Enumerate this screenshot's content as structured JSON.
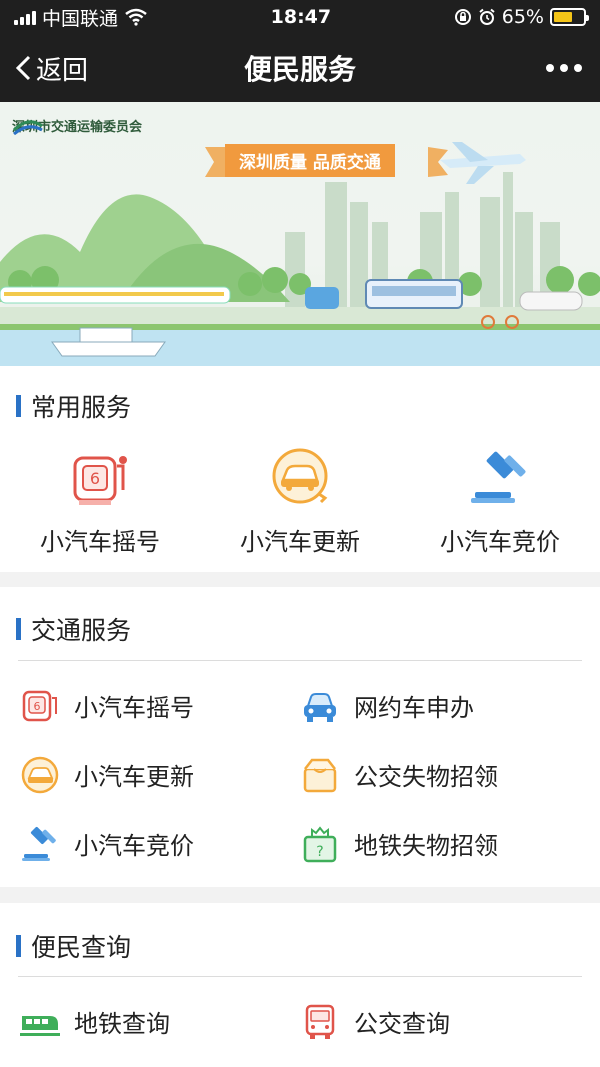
{
  "status": {
    "carrier": "中国联通",
    "time": "18:47",
    "battery": "65%",
    "battery_level": 0.65
  },
  "nav": {
    "back_label": "返回",
    "title": "便民服务"
  },
  "banner": {
    "org": "深圳市交通运输委员会",
    "slogan": "深圳质量  品质交通"
  },
  "common": {
    "title": "常用服务",
    "items": [
      {
        "label": "小汽车摇号",
        "icon": "lottery-icon"
      },
      {
        "label": "小汽车更新",
        "icon": "car-renew-icon"
      },
      {
        "label": "小汽车竞价",
        "icon": "auction-gavel-icon"
      }
    ]
  },
  "traffic": {
    "title": "交通服务",
    "items": [
      {
        "label": "小汽车摇号",
        "icon": "lottery-icon"
      },
      {
        "label": "网约车申办",
        "icon": "car-front-icon"
      },
      {
        "label": "小汽车更新",
        "icon": "car-renew-icon"
      },
      {
        "label": "公交失物招领",
        "icon": "box-icon"
      },
      {
        "label": "小汽车竞价",
        "icon": "auction-gavel-icon"
      },
      {
        "label": "地铁失物招领",
        "icon": "bag-question-icon"
      }
    ]
  },
  "query": {
    "title": "便民查询",
    "items": [
      {
        "label": "地铁查询",
        "icon": "metro-train-icon"
      },
      {
        "label": "公交查询",
        "icon": "bus-icon"
      }
    ]
  }
}
